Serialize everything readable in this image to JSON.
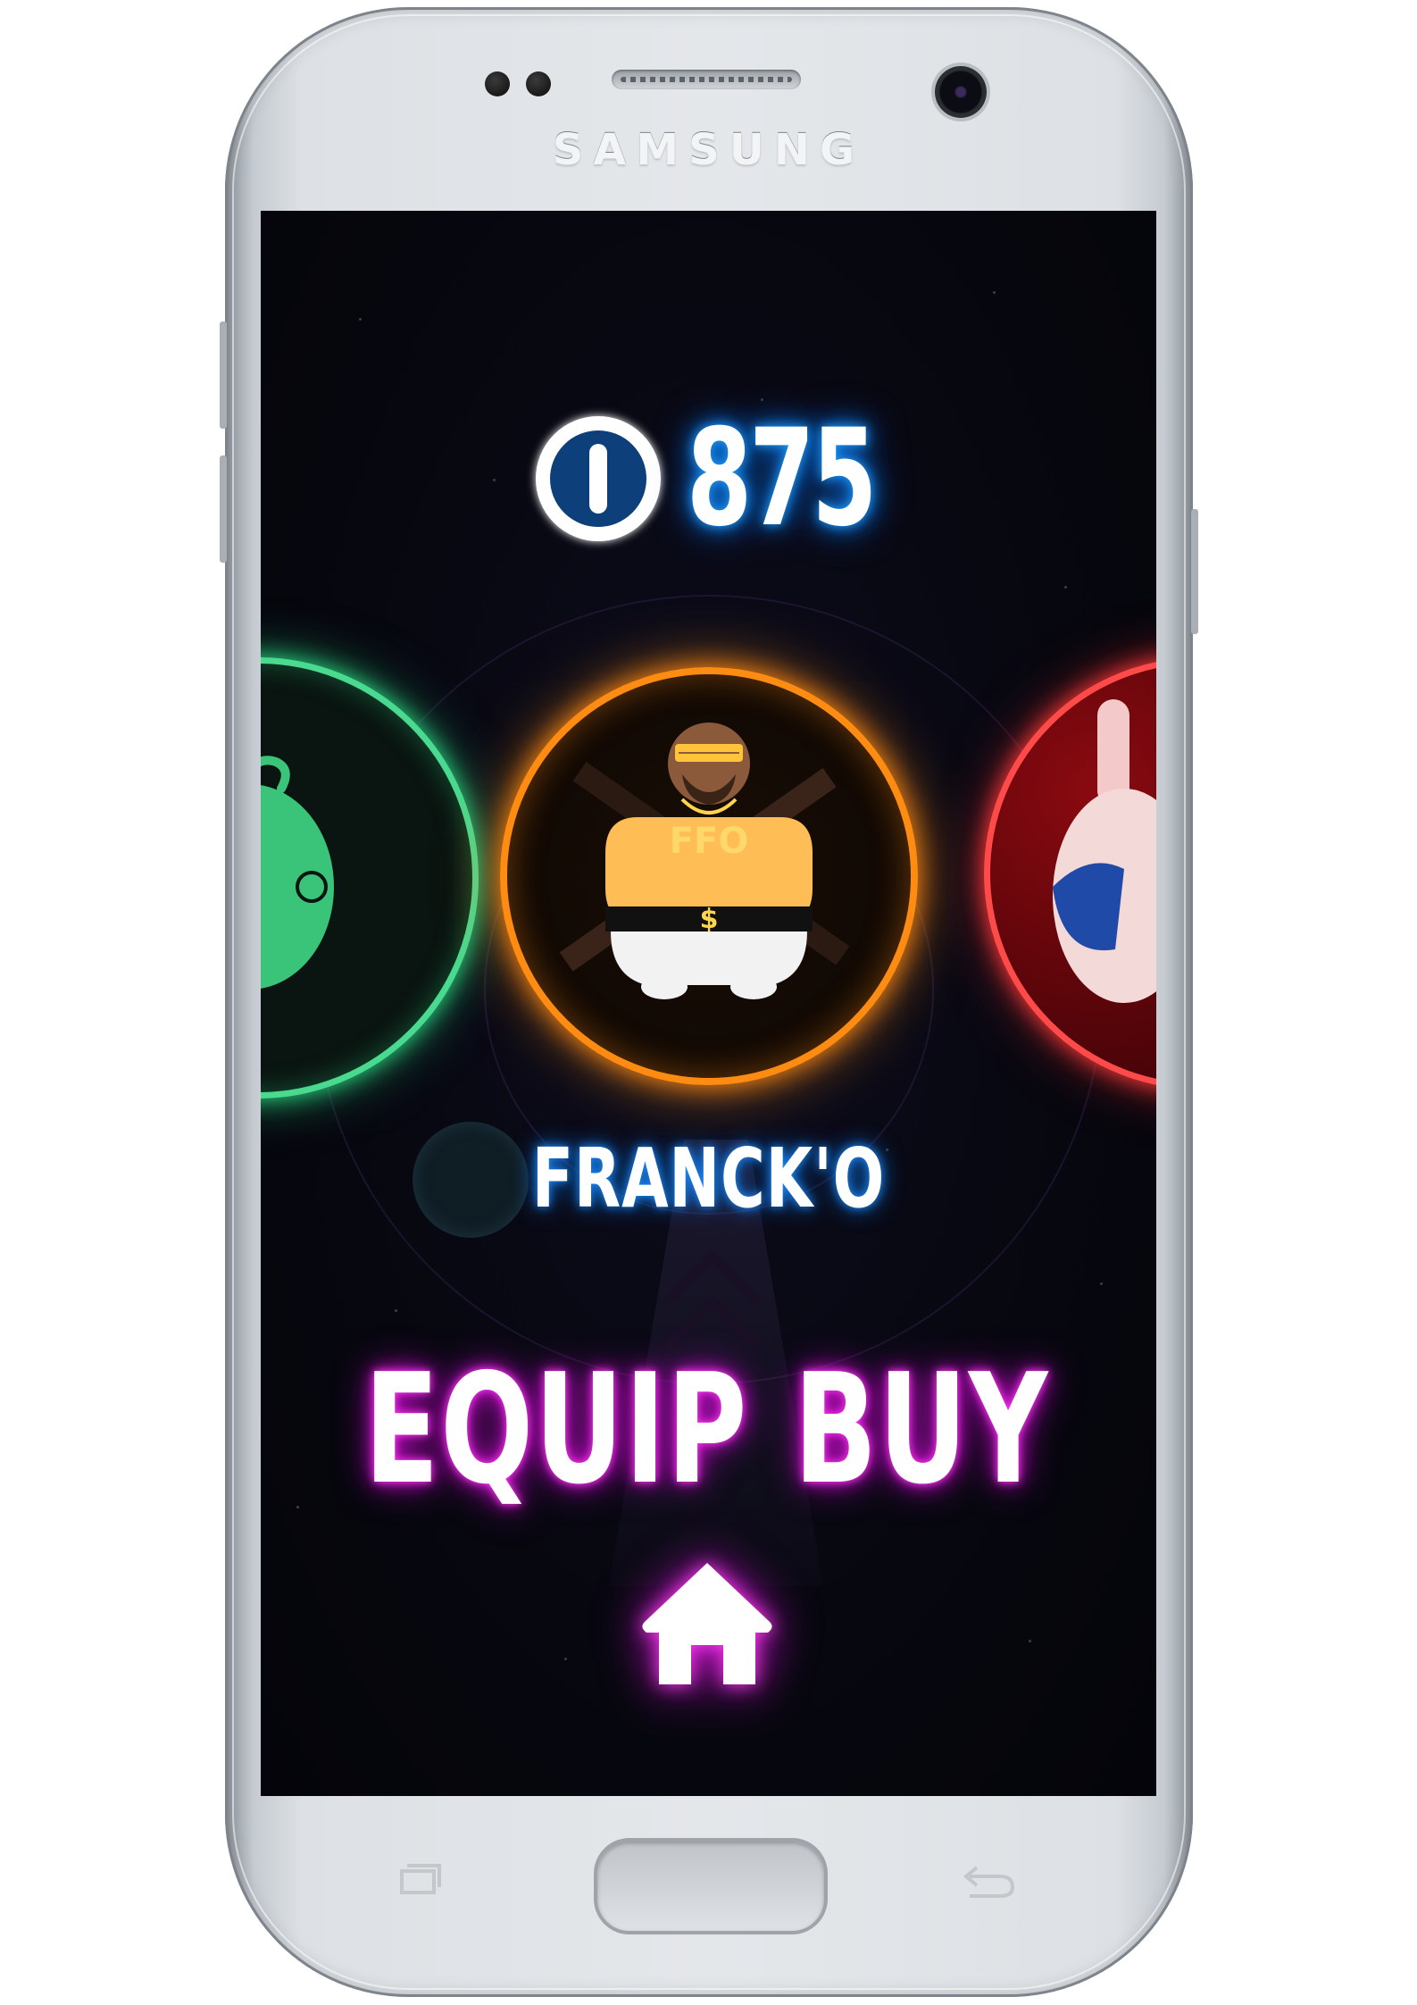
{
  "device": {
    "brand": "SAMSUNG"
  },
  "game": {
    "coins": "875",
    "selected_character": "FRANCK'O",
    "equip_label": "EQUIP",
    "buy_label": "BUY",
    "character_shirt_text": "FFO",
    "character_belt_symbol": "$",
    "colors": {
      "coin_glow": "#1fa0ff",
      "name_glow": "#1f8fff",
      "action_glow": "#d20fd2",
      "left_character_ring": "#49d98f",
      "center_character_ring": "#ff8c12",
      "right_character_ring": "#ff4a4a"
    },
    "icons": {
      "coin": "coin-icon",
      "home": "home-icon"
    }
  }
}
